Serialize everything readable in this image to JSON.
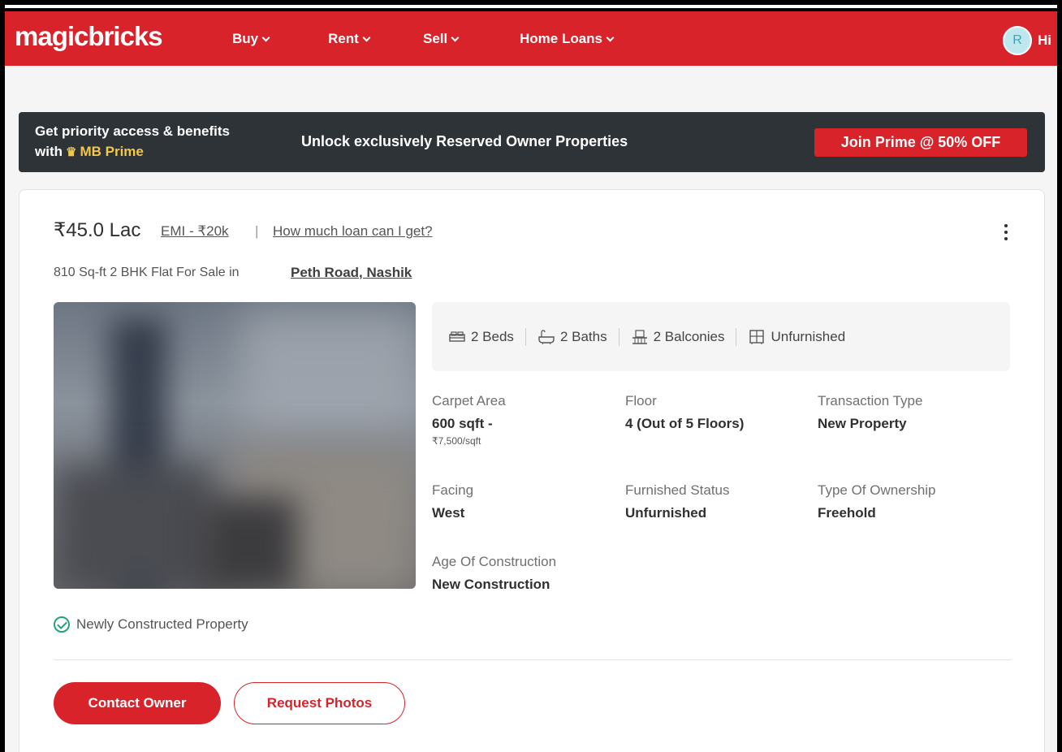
{
  "header": {
    "logo": "magicbricks",
    "nav": [
      "Buy",
      "Rent",
      "Sell",
      "Home Loans"
    ],
    "avatar_initial": "R",
    "greeting": "Hi",
    "brand_color": "#d8232a"
  },
  "prime_banner": {
    "line1": "Get priority access & benefits",
    "line2_prefix": "with",
    "prime_name": "MB Prime",
    "headline": "Unlock exclusively Reserved Owner Properties",
    "cta": "Join Prime @ 50% OFF"
  },
  "listing": {
    "price": "₹45.0 Lac",
    "emi": "EMI - ₹20k",
    "separator": "|",
    "loan_link": "How much loan can I get?",
    "subtitle": "810 Sq-ft 2 BHK Flat For Sale in",
    "locality": "Peth Road, Nashik",
    "summary": {
      "beds": "2 Beds",
      "baths": "2 Baths",
      "balconies": "2 Balconies",
      "furnishing": "Unfurnished"
    },
    "attributes": {
      "carpet_area": {
        "label": "Carpet Area",
        "value": "600 sqft -",
        "sub": "₹7,500/sqft"
      },
      "floor": {
        "label": "Floor",
        "value": "4 (Out of 5 Floors)"
      },
      "transaction": {
        "label": "Transaction Type",
        "value": "New Property"
      },
      "facing": {
        "label": "Facing",
        "value": "West"
      },
      "furnished_status": {
        "label": "Furnished Status",
        "value": "Unfurnished"
      },
      "ownership": {
        "label": "Type Of Ownership",
        "value": "Freehold"
      },
      "age": {
        "label": "Age Of Construction",
        "value": "New Construction"
      }
    },
    "badge": "Newly Constructed Property",
    "contact_button": "Contact Owner",
    "photos_button": "Request Photos"
  }
}
